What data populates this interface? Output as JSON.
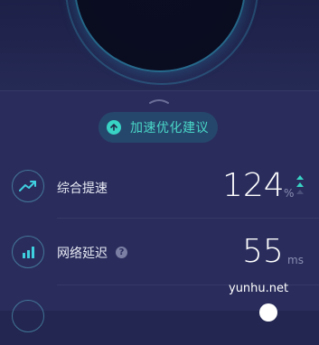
{
  "suggestion": {
    "label": "加速优化建议",
    "icon": "arrow-up-circle-icon"
  },
  "metrics": [
    {
      "title": "综合提速",
      "value": "124",
      "unit": "%",
      "icon": "trend-up-icon",
      "trend": "up"
    },
    {
      "title": "网络延迟",
      "value": "55",
      "unit": "ms",
      "icon": "signal-bars-icon",
      "help": "?"
    }
  ],
  "watermark": "yunhu.net",
  "colors": {
    "accent": "#38d3c4",
    "background": "#2a2d5c",
    "top": "#1d2047"
  }
}
